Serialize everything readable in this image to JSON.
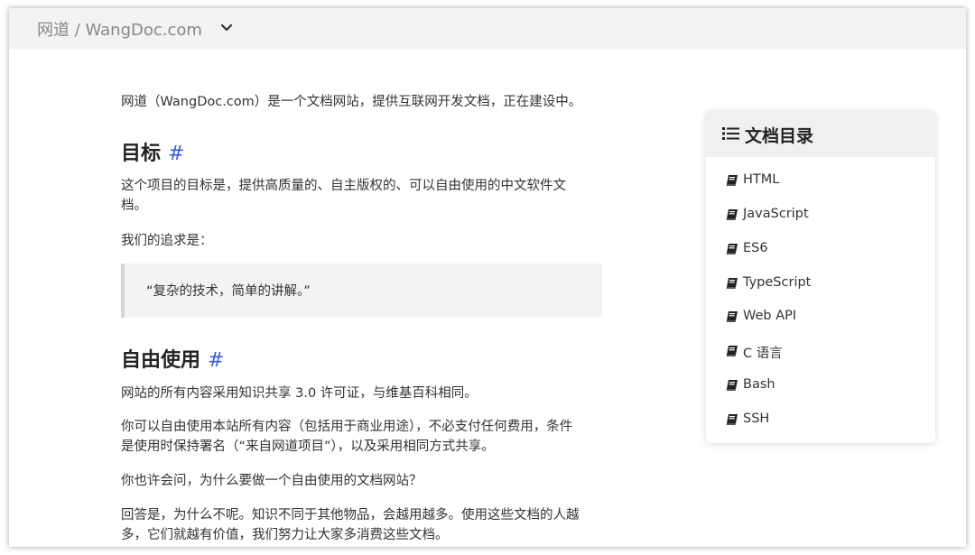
{
  "header": {
    "site_title": "网道 / WangDoc.com",
    "dropdown_icon": "chevron-down-icon"
  },
  "main": {
    "intro": "网道（WangDoc.com）是一个文档网站，提供互联网开发文档，正在建设中。",
    "section_goal": {
      "heading": "目标",
      "anchor": "#",
      "p1_line1": "这个项目的目标是，提供高质量的、自主版权的、可以自由使用的中文软件文",
      "p1_line2": "档。",
      "p2": "我们的追求是：",
      "quote": "“复杂的技术，简单的讲解。”"
    },
    "section_free": {
      "heading": "自由使用",
      "anchor": "#",
      "p1": "网站的所有内容采用知识共享 3.0 许可证，与维基百科相同。",
      "p2_line1": "你可以自由使用本站所有内容（包括用于商业用途），不必支付任何费用，条件",
      "p2_line2": "是使用时保持署名（“来自网道项目”），以及采用相同方式共享。",
      "p3": "你也许会问，为什么要做一个自由使用的文档网站？",
      "p4_line1": "回答是，为什么不呢。知识不同于其他物品，会越用越多。使用这些文档的人越",
      "p4_line2": "多，它们就越有价值，我们努力让大家多消费这些文档。"
    }
  },
  "toc": {
    "title": "文档目录",
    "title_icon": "list-icon",
    "item_icon": "book-icon",
    "items": [
      "HTML",
      "JavaScript",
      "ES6",
      "TypeScript",
      "Web API",
      "C 语言",
      "Bash",
      "SSH"
    ]
  },
  "colors": {
    "anchor": "#3b5bdb",
    "topbar_bg": "#f3f3f3",
    "quote_bg": "#f3f3f3"
  }
}
